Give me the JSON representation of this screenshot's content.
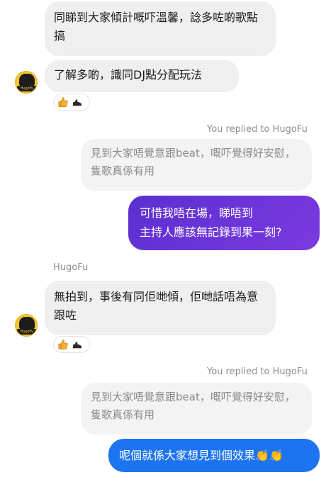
{
  "messages": {
    "m1": {
      "text": "同睇到大家傾計嘅吓溫馨，諗多咗啲歌點搞"
    },
    "m2": {
      "text": "了解多啲，識同DJ點分配玩法"
    },
    "reply1": {
      "meta": "You replied to HugoFu",
      "quote": "見到大家唔覺意跟beat，嘅吓覺得好安慰，隻歌真係有用",
      "text_line1": "可惜我唔在場，睇唔到",
      "text_line2": "主持人應該無記錄到果一刻?"
    },
    "sender2": {
      "name": "HugoFu"
    },
    "m3": {
      "text": "無拍到，事後有同佢哋傾，佢哋話唔為意跟咗"
    },
    "reply2": {
      "meta": "You replied to HugoFu",
      "quote": "見到大家唔覺意跟beat，嘅吓覺得好安慰，隻歌真係有用",
      "text": "呢個就係大家想見到個效果",
      "emoji": "👏👏"
    }
  },
  "reactions": {
    "r1": [
      "thumbs-up",
      "shoe"
    ],
    "r2": [
      "thumbs-up",
      "shoe"
    ]
  },
  "avatar": {
    "label": "HugoFu"
  },
  "colors": {
    "incoming_bg": "#efefef",
    "quote_bg": "#f3f3f3",
    "outgoing_gradient_start": "#5b2fd0",
    "outgoing_gradient_end": "#7b3ae0",
    "outgoing_blue": "#1d74f0"
  }
}
